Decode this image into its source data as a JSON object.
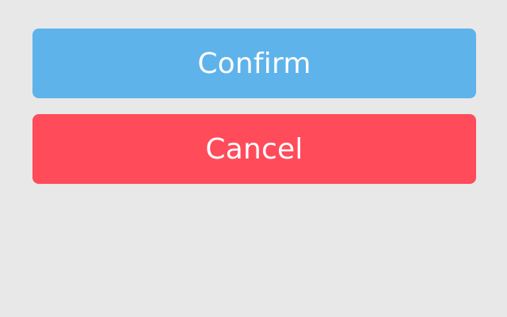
{
  "buttons": {
    "confirm": {
      "label": "Confirm",
      "color": "#5eb3eb"
    },
    "cancel": {
      "label": "Cancel",
      "color": "#ff4b5a"
    }
  },
  "background": "#e8e8e8"
}
